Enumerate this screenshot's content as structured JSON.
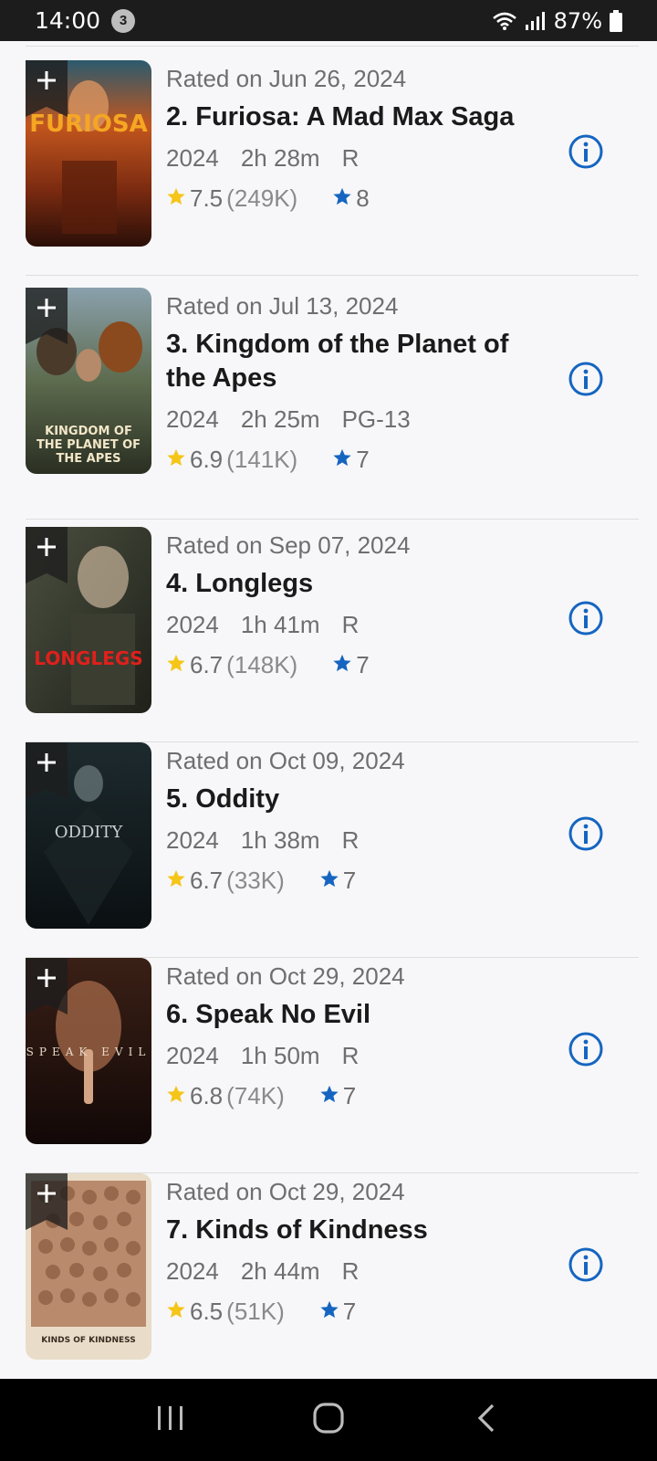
{
  "status": {
    "time": "14:00",
    "notification_count": "3",
    "battery": "87%"
  },
  "movies": [
    {
      "rated_on": "Rated on Jun 26, 2024",
      "title": "2. Furiosa: A Mad Max Saga",
      "year": "2024",
      "runtime": "2h 28m",
      "certificate": "R",
      "imdb_rating": "7.5",
      "votes": "(249K)",
      "my_rating": "8",
      "poster_text": "FURIOSA"
    },
    {
      "rated_on": "Rated on Jul 13, 2024",
      "title": "3. Kingdom of the Planet of the Apes",
      "year": "2024",
      "runtime": "2h 25m",
      "certificate": "PG-13",
      "imdb_rating": "6.9",
      "votes": "(141K)",
      "my_rating": "7",
      "poster_text": "KINGDOM OF THE PLANET OF THE APES"
    },
    {
      "rated_on": "Rated on Sep 07, 2024",
      "title": "4. Longlegs",
      "year": "2024",
      "runtime": "1h 41m",
      "certificate": "R",
      "imdb_rating": "6.7",
      "votes": "(148K)",
      "my_rating": "7",
      "poster_text": "LONGLEGS"
    },
    {
      "rated_on": "Rated on Oct 09, 2024",
      "title": "5. Oddity",
      "year": "2024",
      "runtime": "1h 38m",
      "certificate": "R",
      "imdb_rating": "6.7",
      "votes": "(33K)",
      "my_rating": "7",
      "poster_text": "ODDITY"
    },
    {
      "rated_on": "Rated on Oct 29, 2024",
      "title": "6. Speak No Evil",
      "year": "2024",
      "runtime": "1h 50m",
      "certificate": "R",
      "imdb_rating": "6.8",
      "votes": "(74K)",
      "my_rating": "7",
      "poster_text": "SPEAK EVIL"
    },
    {
      "rated_on": "Rated on Oct 29, 2024",
      "title": "7. Kinds of Kindness",
      "year": "2024",
      "runtime": "2h 44m",
      "certificate": "R",
      "imdb_rating": "6.5",
      "votes": "(51K)",
      "my_rating": "7",
      "poster_text": "KINDS OF KINDNESS"
    }
  ],
  "colors": {
    "imdb_star": "#f5c518",
    "my_star": "#1565c0",
    "info_icon": "#1565c0"
  },
  "icons": {
    "add": "plus-icon",
    "imdb_star": "star-icon",
    "my_rating": "blue-star-icon",
    "info": "info-circle-icon",
    "nav_recent": "recent-apps-icon",
    "nav_home": "home-icon",
    "nav_back": "back-icon"
  }
}
